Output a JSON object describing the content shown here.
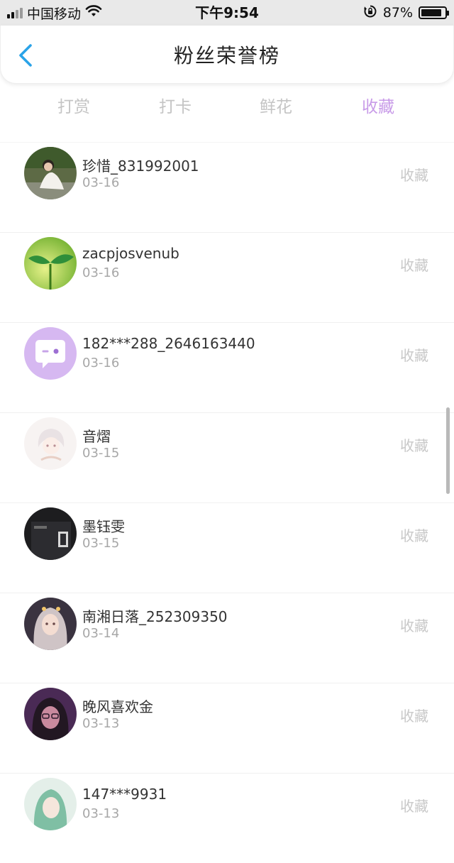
{
  "status_bar": {
    "carrier": "中国移动",
    "time": "下午9:54",
    "battery_percent": "87%",
    "battery_level": 0.87
  },
  "header": {
    "title": "粉丝荣誉榜"
  },
  "tabs": [
    {
      "label": "打赏",
      "active": false
    },
    {
      "label": "打卡",
      "active": false
    },
    {
      "label": "鲜花",
      "active": false
    },
    {
      "label": "收藏",
      "active": true
    }
  ],
  "colors": {
    "accent": "#c89be8",
    "tab_inactive": "#c4c4c4",
    "back_arrow": "#2aa3e8"
  },
  "fans": [
    {
      "name": "珍惜_831992001",
      "date": "03-16",
      "action": "收藏"
    },
    {
      "name": "zacpjosvenub",
      "date": "03-16",
      "action": "收藏"
    },
    {
      "name": "182***288_2646163440",
      "date": "03-16",
      "action": "收藏"
    },
    {
      "name": "音熠",
      "date": "03-15",
      "action": "收藏"
    },
    {
      "name": "墨钰雯",
      "date": "03-15",
      "action": "收藏"
    },
    {
      "name": "南湘日落_252309350",
      "date": "03-14",
      "action": "收藏"
    },
    {
      "name": "晚风喜欢金",
      "date": "03-13",
      "action": "收藏"
    },
    {
      "name": "147***9931",
      "date": "03-13",
      "action": "收藏"
    }
  ]
}
